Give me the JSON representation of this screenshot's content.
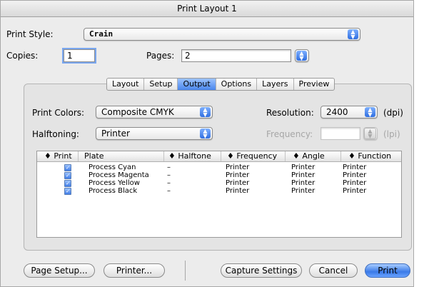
{
  "window": {
    "title": "Print Layout 1"
  },
  "print_style": {
    "label": "Print Style:",
    "value": "Crain"
  },
  "copies": {
    "label": "Copies:",
    "value": "1"
  },
  "pages": {
    "label": "Pages:",
    "value": "2"
  },
  "tabs": [
    {
      "label": "Layout",
      "active": false
    },
    {
      "label": "Setup",
      "active": false
    },
    {
      "label": "Output",
      "active": true
    },
    {
      "label": "Options",
      "active": false
    },
    {
      "label": "Layers",
      "active": false
    },
    {
      "label": "Preview",
      "active": false
    }
  ],
  "print_colors": {
    "label": "Print Colors:",
    "value": "Composite CMYK"
  },
  "resolution": {
    "label": "Resolution:",
    "value": "2400",
    "unit": "(dpi)"
  },
  "halftoning": {
    "label": "Halftoning:",
    "value": "Printer"
  },
  "frequency": {
    "label": "Frequency:",
    "value": "",
    "unit": "(lpi)",
    "enabled": false
  },
  "plates_table": {
    "headers": [
      "♦ Print",
      "Plate",
      "♦ Halftone",
      "♦ Frequency",
      "♦ Angle",
      "♦ Function"
    ],
    "rows": [
      {
        "print": true,
        "plate": "Process Cyan",
        "halftone": "–",
        "frequency": "Printer",
        "angle": "Printer",
        "function": "Printer"
      },
      {
        "print": true,
        "plate": "Process Magenta",
        "halftone": "–",
        "frequency": "Printer",
        "angle": "Printer",
        "function": "Printer"
      },
      {
        "print": true,
        "plate": "Process Yellow",
        "halftone": "–",
        "frequency": "Printer",
        "angle": "Printer",
        "function": "Printer"
      },
      {
        "print": true,
        "plate": "Process Black",
        "halftone": "–",
        "frequency": "Printer",
        "angle": "Printer",
        "function": "Printer"
      }
    ]
  },
  "buttons": {
    "page_setup": "Page Setup...",
    "printer": "Printer...",
    "capture_settings": "Capture Settings",
    "cancel": "Cancel",
    "print": "Print"
  },
  "colors": {
    "accent": "#3a7ae8",
    "window_bg": "#ececec"
  },
  "icons": {
    "popup_arrows": "up-down-arrows-icon",
    "checkbox": "checkmark-icon"
  }
}
